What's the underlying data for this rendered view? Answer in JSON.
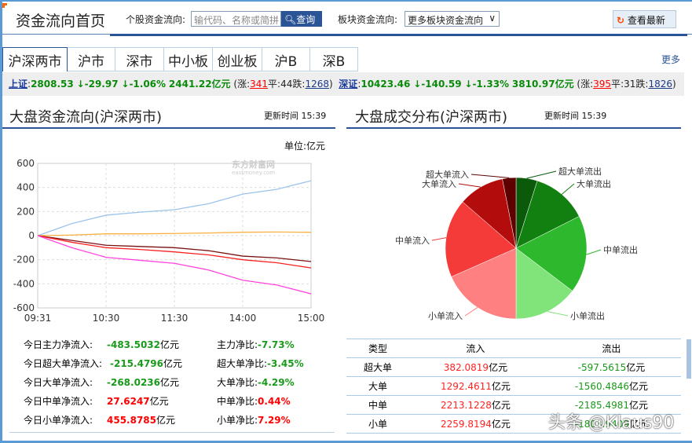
{
  "header": {
    "title": "资金流向首页",
    "stock_label": "个股资金流向:",
    "search_placeholder": "输代码、名称或简拼",
    "search_button": "查询",
    "sector_label": "板块资金流向:",
    "sector_select": "更多板块资金流向",
    "refresh_button": "查看最新"
  },
  "tabs": [
    "沪深两市",
    "沪市",
    "深市",
    "中小板",
    "创业板",
    "沪B",
    "深B"
  ],
  "more": "更多",
  "index_bar": {
    "sh": {
      "name": "上证",
      "price": "2808.53",
      "change": "-29.97",
      "pct": "-1.06%",
      "amount": "2441.22亿元",
      "up": "341",
      "flat": "44",
      "down": "1268"
    },
    "sz": {
      "name": "深证",
      "price": "10423.46",
      "change": "-140.59",
      "pct": "-1.33%",
      "amount": "3810.97亿元",
      "up": "395",
      "flat": "31",
      "down": "1826"
    },
    "up_label": "涨",
    "flat_label": "平",
    "down_label": "跌"
  },
  "left_panel": {
    "title": "大盘资金流向(沪深两市)",
    "update_label": "更新时间",
    "update_time": "15:39",
    "unit": "单位:亿元",
    "watermark": "东方财富网",
    "watermark_sub": "eastmoney.com"
  },
  "right_panel": {
    "title": "大盘成交分布(沪深两市)",
    "update_label": "更新时间",
    "update_time": "15:39"
  },
  "stats": [
    {
      "label": "今日主力净流入:",
      "value": "-483.5032",
      "unit": "亿元",
      "ratio_label": "主力净比:",
      "ratio": "-7.73%",
      "dir": "g"
    },
    {
      "label": "今日超大单净流入:",
      "value": "-215.4796",
      "unit": "亿元",
      "ratio_label": "超大单净比:",
      "ratio": "-3.45%",
      "dir": "g"
    },
    {
      "label": "今日大单净流入:",
      "value": "-268.0236",
      "unit": "亿元",
      "ratio_label": "大单净比:",
      "ratio": "-4.29%",
      "dir": "g"
    },
    {
      "label": "今日中单净流入:",
      "value": "27.6247",
      "unit": "亿元",
      "ratio_label": "中单净比:",
      "ratio": "0.44%",
      "dir": "r"
    },
    {
      "label": "今日小单净流入:",
      "value": "455.8785",
      "unit": "亿元",
      "ratio_label": "小单净比:",
      "ratio": "7.29%",
      "dir": "r"
    }
  ],
  "table": {
    "headers": [
      "类型",
      "流入",
      "流出"
    ],
    "unit": "亿元",
    "rows": [
      {
        "type": "超大单",
        "in": "382.0819",
        "out": "-597.5615"
      },
      {
        "type": "大单",
        "in": "1292.4611",
        "out": "-1560.4846"
      },
      {
        "type": "中单",
        "in": "2213.1228",
        "out": "-2185.4981"
      },
      {
        "type": "小单",
        "in": "2259.8194",
        "out": "-1803.9409"
      }
    ]
  },
  "watermark": "头条 @Klaus90",
  "chart_data": [
    {
      "type": "line",
      "title": "大盘资金流向(沪深两市)",
      "ylabel": "亿元",
      "ylim": [
        -600,
        600
      ],
      "yticks": [
        "600",
        "400",
        "200",
        "0",
        "-200",
        "-400",
        "-600"
      ],
      "xticks": [
        "09:31",
        "10:30",
        "11:30",
        "14:00",
        "15:00"
      ],
      "grid": true,
      "series": [
        {
          "name": "小单",
          "color": "#9cc3ec",
          "values": [
            0,
            100,
            170,
            195,
            215,
            265,
            345,
            385,
            456
          ]
        },
        {
          "name": "中单",
          "color": "#f9b040",
          "values": [
            0,
            5,
            15,
            15,
            18,
            22,
            28,
            30,
            28
          ]
        },
        {
          "name": "超大单",
          "color": "#7a1010",
          "values": [
            0,
            -40,
            -80,
            -90,
            -100,
            -125,
            -170,
            -185,
            -215
          ]
        },
        {
          "name": "大单",
          "color": "#f52020",
          "values": [
            0,
            -55,
            -100,
            -115,
            -135,
            -160,
            -200,
            -225,
            -268
          ]
        },
        {
          "name": "主力",
          "color": "#ff44dd",
          "values": [
            0,
            -100,
            -180,
            -205,
            -230,
            -285,
            -370,
            -410,
            -483
          ]
        }
      ]
    },
    {
      "type": "pie",
      "title": "大盘成交分布(沪深两市)",
      "slices": [
        {
          "label": "超大单流出",
          "value": 597.5615,
          "color": "#0b5a0b"
        },
        {
          "label": "大单流出",
          "value": 1560.4846,
          "color": "#118011"
        },
        {
          "label": "中单流出",
          "value": 2185.4981,
          "color": "#2db82d"
        },
        {
          "label": "小单流出",
          "value": 1803.9409,
          "color": "#80e47a"
        },
        {
          "label": "小单流入",
          "value": 2259.8194,
          "color": "#ff8080"
        },
        {
          "label": "中单流入",
          "value": 2213.1228,
          "color": "#f53a3a"
        },
        {
          "label": "大单流入",
          "value": 1292.4611,
          "color": "#b30c0c"
        },
        {
          "label": "超大单流入",
          "value": 382.0819,
          "color": "#5e0000"
        }
      ]
    }
  ]
}
